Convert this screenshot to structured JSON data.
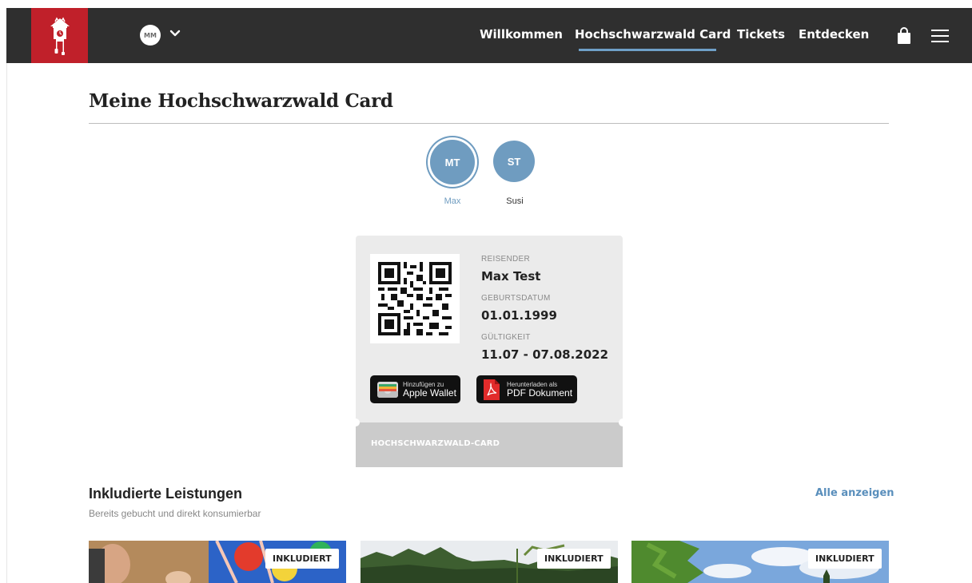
{
  "header": {
    "avatar_initials": "MM",
    "nav": [
      {
        "label": "Willkommen",
        "active": false
      },
      {
        "label": "Hochschwarzwald Card",
        "active": true
      },
      {
        "label": "Tickets",
        "active": false
      },
      {
        "label": "Entdecken",
        "active": false
      }
    ],
    "accent_color": "#6fa0c8",
    "logo_color": "#c0202a"
  },
  "page": {
    "title": "Meine Hochschwarzwald Card"
  },
  "travelers": [
    {
      "initials": "MT",
      "name": "Max",
      "active": true
    },
    {
      "initials": "ST",
      "name": "Susi",
      "active": false
    }
  ],
  "card": {
    "traveler_label": "REISENDER",
    "traveler_name": "Max Test",
    "birthdate_label": "GEBURTSDATUM",
    "birthdate": "01.01.1999",
    "validity_label": "GÜLTIGKEIT",
    "validity": "11.07 - 07.08.2022",
    "wallet_button": {
      "line1": "Hinzufügen zu",
      "line2": "Apple Wallet"
    },
    "pdf_button": {
      "line1": "Herunterladen als",
      "line2": "PDF Dokument"
    },
    "footer_label": "HOCHSCHWARZWALD-CARD"
  },
  "included": {
    "title": "Inkludierte Leistungen",
    "subtitle": "Bereits gebucht und direkt konsumierbar",
    "show_all": "Alle anzeigen",
    "tiles": [
      {
        "badge": "INKLUDIERT"
      },
      {
        "badge": "INKLUDIERT"
      },
      {
        "badge": "INKLUDIERT"
      }
    ]
  }
}
